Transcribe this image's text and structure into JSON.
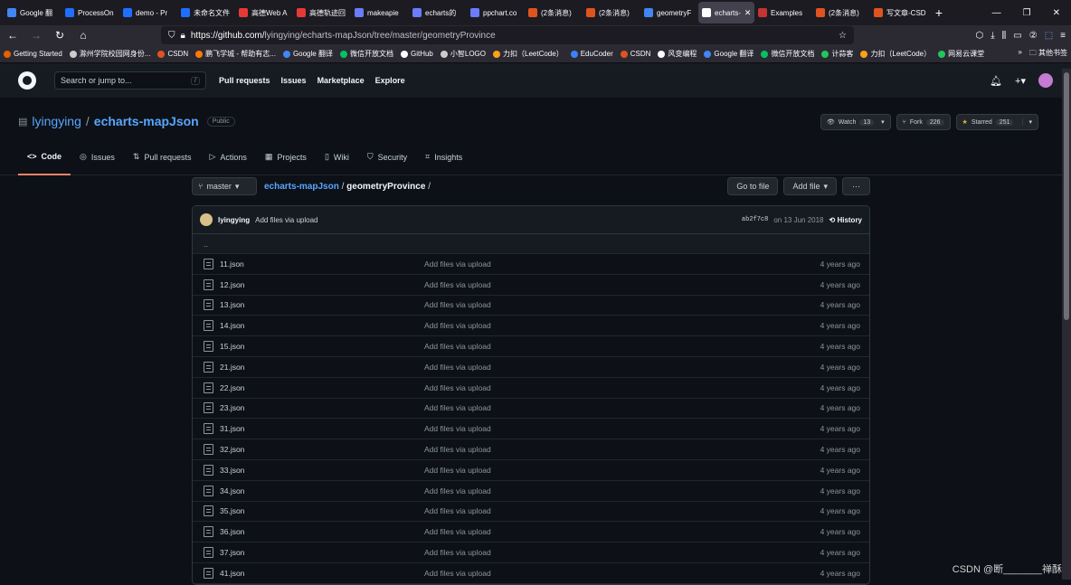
{
  "browser": {
    "tabs": [
      {
        "label": "Google 翻",
        "color": "#4285f4"
      },
      {
        "label": "ProcessOn",
        "color": "#1e6fff"
      },
      {
        "label": "demo - Pr",
        "color": "#1e6fff"
      },
      {
        "label": "未命名文件",
        "color": "#1e6fff"
      },
      {
        "label": "高德Web A",
        "color": "#e53935"
      },
      {
        "label": "高德轨迹回",
        "color": "#e53935"
      },
      {
        "label": "makeapie",
        "color": "#6b7cff"
      },
      {
        "label": "echarts的",
        "color": "#6b7cff"
      },
      {
        "label": "ppchart.co",
        "color": "#6b7cff"
      },
      {
        "label": "(2条消息)",
        "color": "#e0531f"
      },
      {
        "label": "(2条消息)",
        "color": "#e0531f"
      },
      {
        "label": "geometryF",
        "color": "#4285f4"
      },
      {
        "label": "echarts-",
        "color": "#ffffff",
        "active": true
      },
      {
        "label": "Examples",
        "color": "#c23531"
      },
      {
        "label": "(2条消息)",
        "color": "#e0531f"
      },
      {
        "label": "写文章-CSD",
        "color": "#e0531f"
      }
    ],
    "url_host": "https://github.com/",
    "url_path": "lyingying/echarts-mapJson/tree/master/geometryProvince",
    "bookmarks": [
      {
        "label": "Getting Started",
        "color": "#e66000"
      },
      {
        "label": "滁州学院校园网身份...",
        "color": "#cccccc"
      },
      {
        "label": "CSDN",
        "color": "#e0531f"
      },
      {
        "label": "鹏飞学城 - 帮助有志...",
        "color": "#ff7a00"
      },
      {
        "label": "Google 翻译",
        "color": "#4285f4"
      },
      {
        "label": "微信开放文档",
        "color": "#07c160"
      },
      {
        "label": "GitHub",
        "color": "#ffffff"
      },
      {
        "label": "小智LOGO",
        "color": "#cccccc"
      },
      {
        "label": "力扣（LeetCode）",
        "color": "#ffa116"
      },
      {
        "label": "EduCoder",
        "color": "#3b82f6"
      },
      {
        "label": "CSDN",
        "color": "#e0531f"
      },
      {
        "label": "风变编程",
        "color": "#ffffff"
      },
      {
        "label": "Google 翻译",
        "color": "#4285f4"
      },
      {
        "label": "微信开放文档",
        "color": "#07c160"
      },
      {
        "label": "计蒜客",
        "color": "#22c55e"
      },
      {
        "label": "力扣（LeetCode）",
        "color": "#ffa116"
      },
      {
        "label": "网易云课堂",
        "color": "#22c55e"
      }
    ],
    "other_bookmarks": "其他书签"
  },
  "gh": {
    "search_placeholder": "Search or jump to...",
    "slash": "/",
    "nav": [
      "Pull requests",
      "Issues",
      "Marketplace",
      "Explore"
    ]
  },
  "repo": {
    "owner": "lyingying",
    "sep": "/",
    "name": "echarts-mapJson",
    "visibility": "Public",
    "watch": "Watch",
    "watch_count": "13",
    "fork": "Fork",
    "fork_count": "226",
    "star": "Starred",
    "star_count": "251",
    "tabs": [
      "Code",
      "Issues",
      "Pull requests",
      "Actions",
      "Projects",
      "Wiki",
      "Security",
      "Insights"
    ]
  },
  "path": {
    "branch": "master",
    "root": "echarts-mapJson",
    "dir": "geometryProvince",
    "go_to_file": "Go to file",
    "add_file": "Add file",
    "more": "···"
  },
  "commit": {
    "author": "lyingying",
    "message": "Add files via upload",
    "sha": "ab2f7c8",
    "date": "on 13 Jun 2018",
    "history": "History"
  },
  "updir": "..",
  "files": [
    {
      "name": "11.json",
      "msg": "Add files via upload",
      "age": "4 years ago"
    },
    {
      "name": "12.json",
      "msg": "Add files via upload",
      "age": "4 years ago"
    },
    {
      "name": "13.json",
      "msg": "Add files via upload",
      "age": "4 years ago"
    },
    {
      "name": "14.json",
      "msg": "Add files via upload",
      "age": "4 years ago"
    },
    {
      "name": "15.json",
      "msg": "Add files via upload",
      "age": "4 years ago"
    },
    {
      "name": "21.json",
      "msg": "Add files via upload",
      "age": "4 years ago"
    },
    {
      "name": "22.json",
      "msg": "Add files via upload",
      "age": "4 years ago"
    },
    {
      "name": "23.json",
      "msg": "Add files via upload",
      "age": "4 years ago"
    },
    {
      "name": "31.json",
      "msg": "Add files via upload",
      "age": "4 years ago"
    },
    {
      "name": "32.json",
      "msg": "Add files via upload",
      "age": "4 years ago"
    },
    {
      "name": "33.json",
      "msg": "Add files via upload",
      "age": "4 years ago"
    },
    {
      "name": "34.json",
      "msg": "Add files via upload",
      "age": "4 years ago"
    },
    {
      "name": "35.json",
      "msg": "Add files via upload",
      "age": "4 years ago"
    },
    {
      "name": "36.json",
      "msg": "Add files via upload",
      "age": "4 years ago"
    },
    {
      "name": "37.json",
      "msg": "Add files via upload",
      "age": "4 years ago"
    },
    {
      "name": "41.json",
      "msg": "Add files via upload",
      "age": "4 years ago"
    }
  ],
  "watermark": "CSDN @断_______禅酥"
}
